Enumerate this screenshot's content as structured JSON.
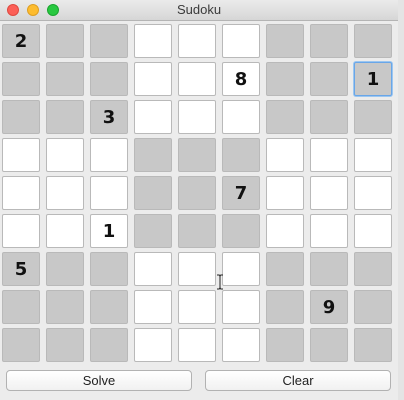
{
  "window": {
    "title": "Sudoku"
  },
  "board": {
    "rows": [
      [
        "2",
        "",
        "",
        "",
        "",
        "",
        "",
        "",
        ""
      ],
      [
        "",
        "",
        "",
        "",
        "",
        "8",
        "",
        "",
        "1"
      ],
      [
        "",
        "",
        "3",
        "",
        "",
        "",
        "",
        "",
        ""
      ],
      [
        "",
        "",
        "",
        "",
        "",
        "",
        "",
        "",
        ""
      ],
      [
        "",
        "",
        "",
        "",
        "",
        "7",
        "",
        "",
        ""
      ],
      [
        "",
        "",
        "1",
        "",
        "",
        "",
        "",
        "",
        ""
      ],
      [
        "5",
        "",
        "",
        "",
        "",
        "",
        "",
        "",
        ""
      ],
      [
        "",
        "",
        "",
        "",
        "",
        "",
        "",
        "9",
        ""
      ],
      [
        "",
        "",
        "",
        "",
        "",
        "",
        "",
        "",
        ""
      ]
    ],
    "focused_cell": "row 2, column 9",
    "shading": "alternating gray and white 3x3 boxes",
    "colors": {
      "gray_cell": "#c8c8c8",
      "white_cell": "#ffffff",
      "focus_ring": "#69a6e8"
    }
  },
  "buttons": {
    "solve_label": "Solve",
    "clear_label": "Clear"
  },
  "cursor": {
    "type": "text-beam-cursor"
  }
}
